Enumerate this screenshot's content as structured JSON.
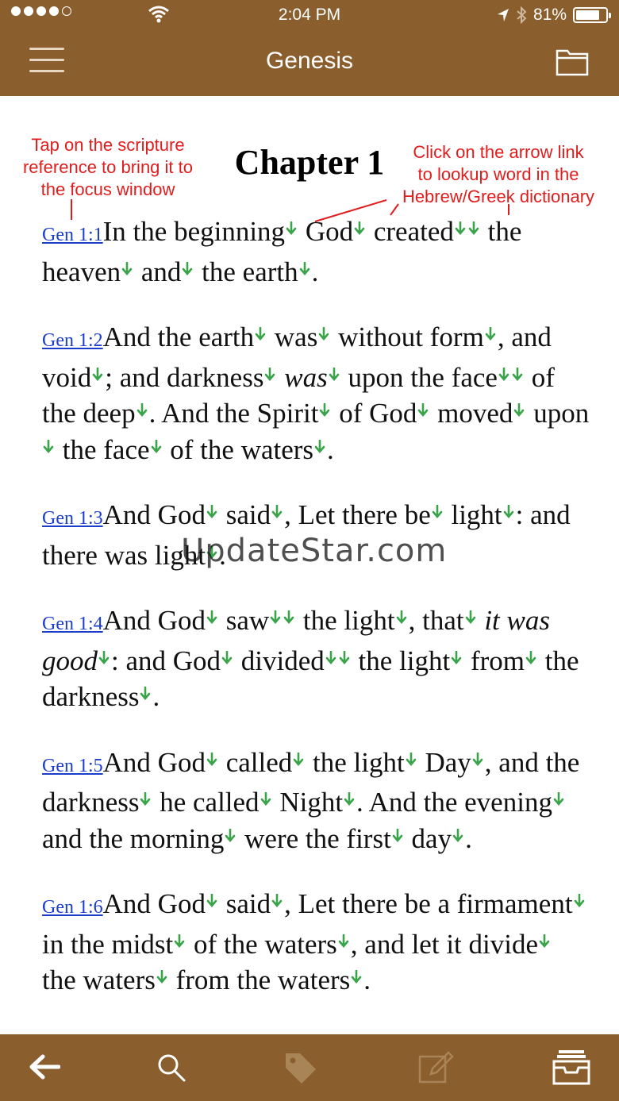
{
  "status_bar": {
    "time": "2:04 PM",
    "battery": "81%",
    "battery_level": 0.81
  },
  "nav": {
    "title": "Genesis"
  },
  "chapter_title": "Chapter 1",
  "annotations": {
    "left_line1": "Tap on the scripture",
    "left_line2": "reference to bring it to",
    "left_line3": "the focus window",
    "right_line1": "Click on the arrow link",
    "right_line2": "to lookup word in the",
    "right_line3": "Hebrew/Greek dictionary"
  },
  "watermark": "UpdateStar.com",
  "verses": [
    {
      "ref": "Gen 1:1",
      "parts": [
        "In the beginning",
        " God",
        " created",
        "",
        " the heaven",
        " and",
        " the earth",
        "."
      ]
    },
    {
      "ref": "Gen 1:2",
      "parts": [
        "And the earth",
        " was",
        " without form",
        ", and void",
        "; and darkness",
        " was",
        " upon the face",
        "",
        " of the deep",
        ". And the Spirit",
        " of God",
        " moved",
        " upon",
        " the face",
        " of the waters",
        "."
      ]
    },
    {
      "ref": "Gen 1:3",
      "parts": [
        "And God",
        " said",
        ", Let there be",
        " light",
        ": and there was light",
        "."
      ]
    },
    {
      "ref": "Gen 1:4",
      "parts": [
        "And God",
        " saw",
        "",
        " the light",
        ", that",
        " it was good",
        ": and God",
        " divided",
        "",
        " the light",
        " from",
        " the darkness",
        "."
      ]
    },
    {
      "ref": "Gen 1:5",
      "parts": [
        "And God",
        " called",
        " the light",
        " Day",
        ", and the darkness",
        " he called",
        " Night",
        ". And the evening",
        " and the morning",
        " were the first",
        " day",
        "."
      ]
    },
    {
      "ref": "Gen 1:6",
      "parts": [
        "And God",
        " said",
        ", Let there be a firmament",
        " in the midst",
        " of the waters",
        ", and let it divide",
        " the waters",
        " from the waters",
        "."
      ]
    }
  ],
  "tabs": [
    "back-arrow-icon",
    "search-icon",
    "tag-icon",
    "edit-icon",
    "inbox-tray-icon"
  ]
}
